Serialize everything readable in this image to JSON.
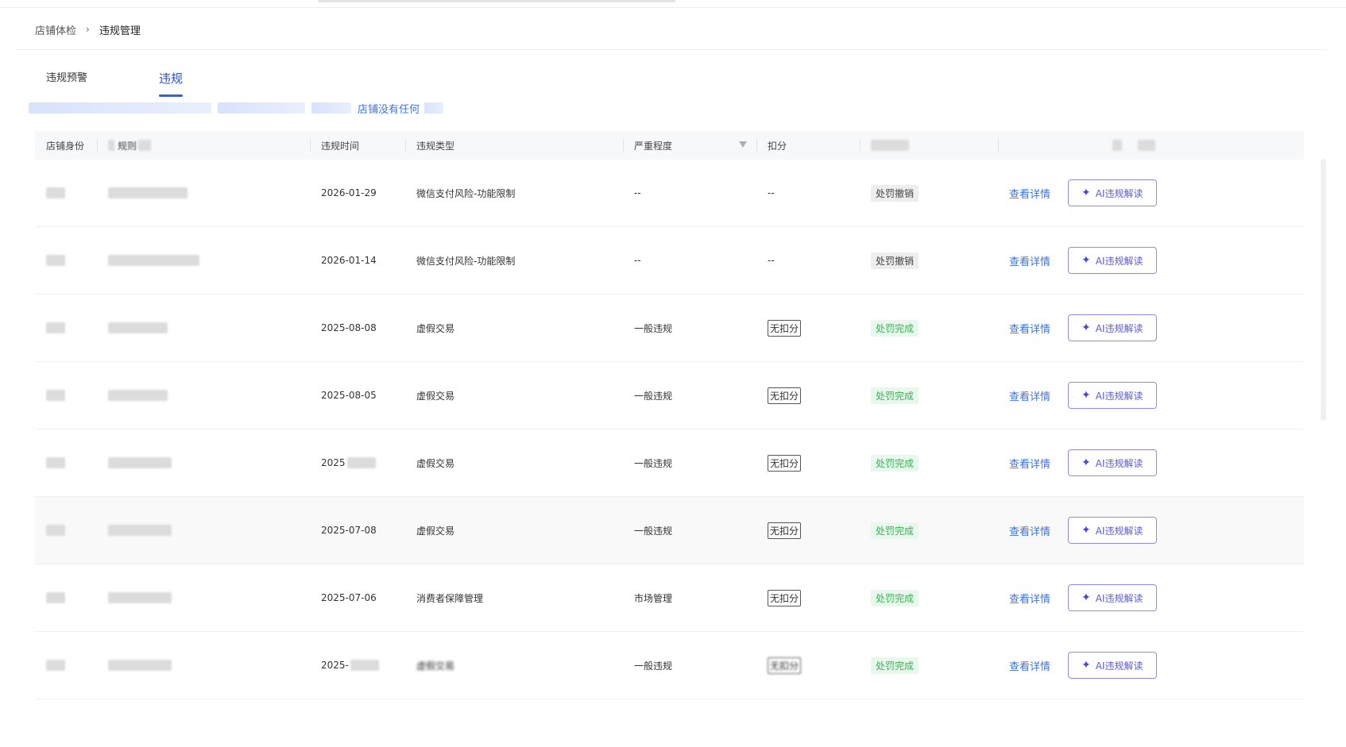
{
  "breadcrumb": {
    "parent": "店铺体检",
    "current": "违规管理"
  },
  "tabs": [
    {
      "label": "违规预警"
    },
    {
      "label": "违规"
    }
  ],
  "notice": {
    "text": "店铺没有任何"
  },
  "table": {
    "headers": {
      "identity": "店铺身份",
      "name": "规则",
      "time": "违规时间",
      "type": "违规类型",
      "severity": "严重程度",
      "score": "扣分",
      "status": "",
      "actions": ""
    },
    "rows": [
      {
        "time": "2026-01-29",
        "type": "微信支付风险-功能限制",
        "severity": "--",
        "score": "--",
        "status": "处罚撤销",
        "detail": "查看详情",
        "ai": "AI违规解读"
      },
      {
        "time": "2026-01-14",
        "type": "微信支付风险-功能限制",
        "severity": "--",
        "score": "--",
        "status": "处罚撤销",
        "detail": "查看详情",
        "ai": "AI违规解读"
      },
      {
        "time": "2025-08-08",
        "type": "虚假交易",
        "severity": "一般违规",
        "score": "无扣分",
        "status": "处罚完成",
        "detail": "查看详情",
        "ai": "AI违规解读"
      },
      {
        "time": "2025-08-05",
        "type": "虚假交易",
        "severity": "一般违规",
        "score": "无扣分",
        "status": "处罚完成",
        "detail": "查看详情",
        "ai": "AI违规解读"
      },
      {
        "time": "2025",
        "type": "虚假交易",
        "severity": "一般违规",
        "score": "无扣分",
        "status": "处罚完成",
        "detail": "查看详情",
        "ai": "AI违规解读"
      },
      {
        "time": "2025-07-08",
        "type": "虚假交易",
        "severity": "一般违规",
        "score": "无扣分",
        "status": "处罚完成",
        "detail": "查看详情",
        "ai": "AI违规解读"
      },
      {
        "time": "2025-07-06",
        "type": "消费者保障管理",
        "severity": "市场管理",
        "score": "无扣分",
        "status": "处罚完成",
        "detail": "查看详情",
        "ai": "AI违规解读"
      },
      {
        "time": "2025-",
        "type": "虚假交易",
        "severity": "一般违规",
        "score": "无扣分",
        "status": "处罚完成",
        "detail": "查看详情",
        "ai": "AI违规解读"
      }
    ]
  },
  "icons": {
    "breadcrumb_sep": "chevron-right-icon",
    "filter": "filter-icon",
    "ai": "sparkle-icon"
  },
  "colors": {
    "accent": "#3b73e8",
    "success": "#35b552",
    "ai_border": "#8c8cf0"
  }
}
